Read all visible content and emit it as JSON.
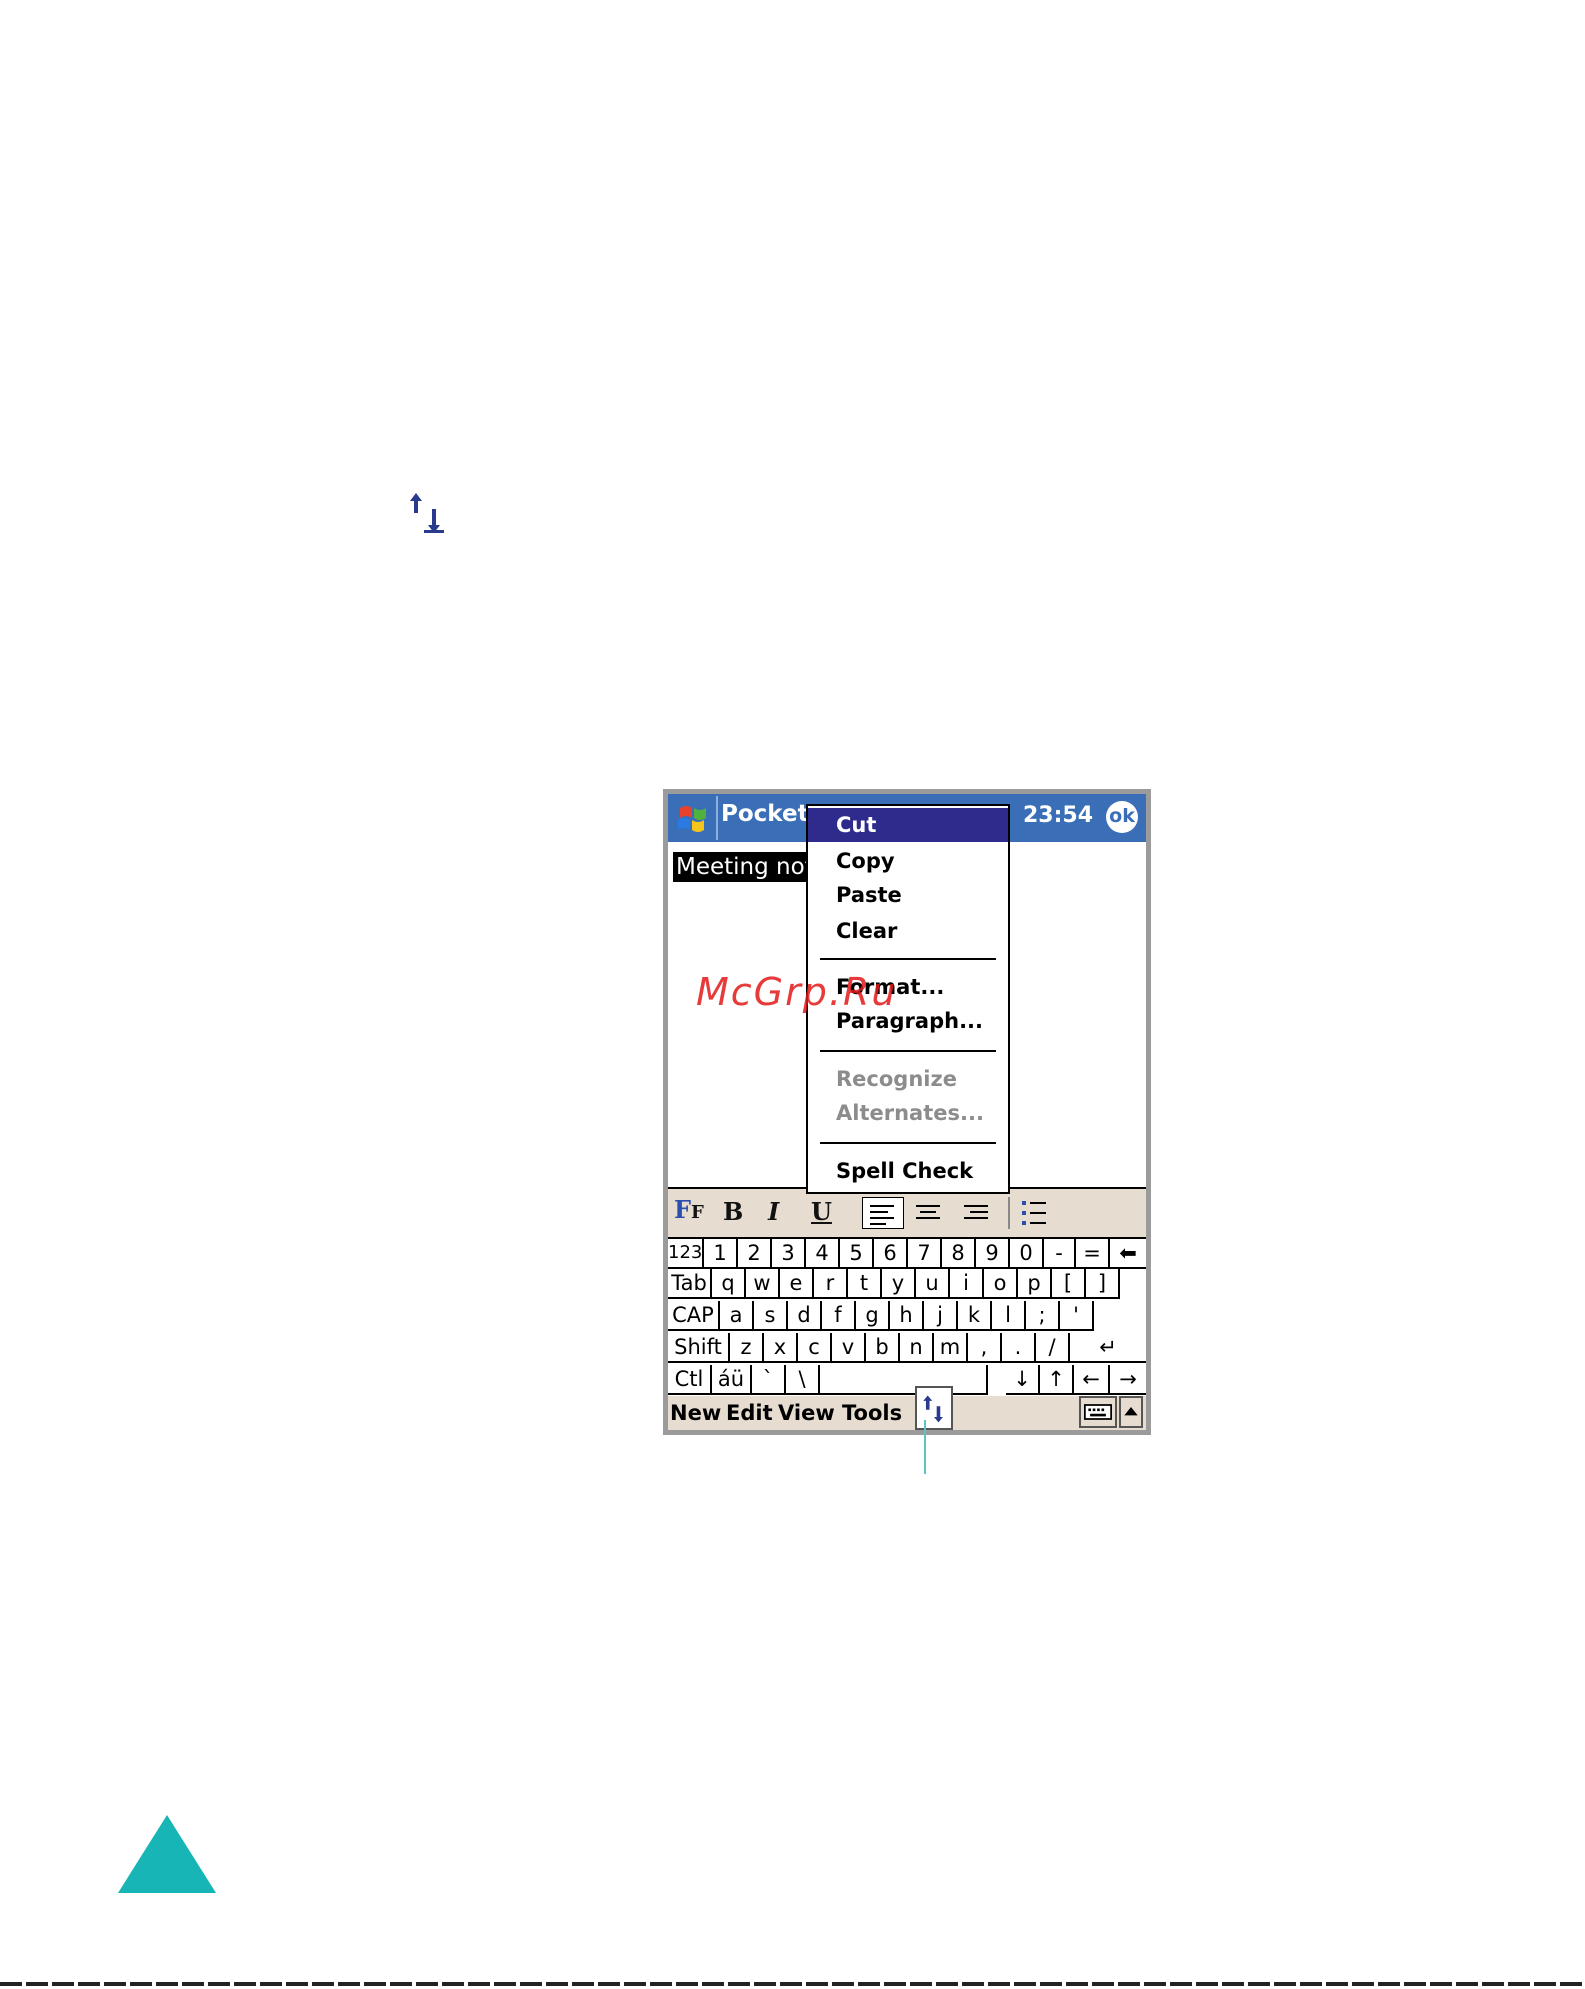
{
  "titlebar": {
    "title": "Pocket",
    "clock": "23:54",
    "ok_label": "ok"
  },
  "note": {
    "selected_text": "Meeting not"
  },
  "popup_menu": {
    "items": [
      {
        "label": "Cut",
        "state": "selected"
      },
      {
        "label": "Copy",
        "state": "enabled"
      },
      {
        "label": "Paste",
        "state": "enabled"
      },
      {
        "label": "Clear",
        "state": "enabled"
      },
      {
        "label": "Format...",
        "state": "enabled"
      },
      {
        "label": "Paragraph...",
        "state": "enabled"
      },
      {
        "label": "Recognize",
        "state": "disabled"
      },
      {
        "label": "Alternates...",
        "state": "disabled"
      },
      {
        "label": "Spell Check",
        "state": "enabled"
      }
    ]
  },
  "format_toolbar": {
    "bold": "B",
    "italic": "I",
    "underline": "U"
  },
  "keyboard": {
    "row1": [
      "123",
      "1",
      "2",
      "3",
      "4",
      "5",
      "6",
      "7",
      "8",
      "9",
      "0",
      "-",
      "=",
      "⬅"
    ],
    "row2": [
      "Tab",
      "q",
      "w",
      "e",
      "r",
      "t",
      "y",
      "u",
      "i",
      "o",
      "p",
      "[",
      "]"
    ],
    "row3": [
      "CAP",
      "a",
      "s",
      "d",
      "f",
      "g",
      "h",
      "j",
      "k",
      "l",
      ";",
      "'"
    ],
    "row4": [
      "Shift",
      "z",
      "x",
      "c",
      "v",
      "b",
      "n",
      "m",
      ",",
      ".",
      "/",
      "↵"
    ],
    "row5": [
      "Ctl",
      "áü",
      "`",
      "\\",
      "",
      "↓",
      "↑",
      "←",
      "→"
    ]
  },
  "menubar": {
    "items": [
      "New",
      "Edit",
      "View",
      "Tools"
    ]
  },
  "watermark": "McGrp.Ru",
  "colors": {
    "titlebar": "#3a6fb8",
    "menu_highlight": "#2f2b8c",
    "toolbar_bg": "#e7dcd0",
    "triangle": "#17b5b5",
    "watermark": "#e31a1a"
  },
  "icons": [
    "sync-icon",
    "windows-start-icon",
    "keyboard-icon",
    "bullets-icon",
    "align-left-icon",
    "align-center-icon",
    "align-right-icon",
    "font-icon"
  ]
}
